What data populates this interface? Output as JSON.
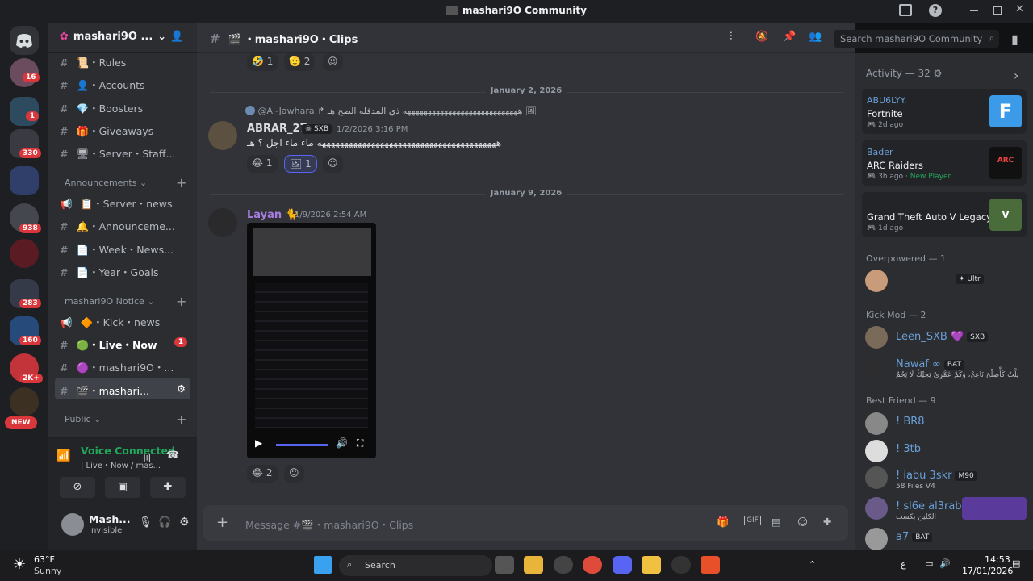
{
  "window": {
    "title": "mashari9O Community"
  },
  "server": {
    "name": "mashari9O ..."
  },
  "badges": [
    "16",
    "1",
    "330",
    "938",
    "283",
    "160",
    "2K+",
    "NEW"
  ],
  "channels": {
    "items": [
      {
        "label": "・Rules",
        "icon": "📜"
      },
      {
        "label": "・Accounts",
        "icon": "👤"
      },
      {
        "label": "・Boosters",
        "icon": "💎"
      },
      {
        "label": "・Giveaways",
        "icon": "🎁"
      },
      {
        "label": "・Server・Staff...",
        "icon": "🖥"
      }
    ],
    "cat_announcements": "Announcements",
    "announce_items": [
      {
        "label": "・Server・news",
        "icon": "📋"
      },
      {
        "label": "・Announceme...",
        "icon": "🔔"
      },
      {
        "label": "・Week・News...",
        "icon": "📄"
      },
      {
        "label": "・Year・Goals",
        "icon": "📄"
      }
    ],
    "cat_notice": "mashari9O Notice",
    "notice_items": [
      {
        "label": "・Kick・news",
        "icon": "🔶"
      },
      {
        "label": "・Live・Now",
        "icon": "🟢",
        "badge": "1"
      },
      {
        "label": "・mashari9O・...",
        "icon": "🟣"
      },
      {
        "label": "・mashari...",
        "icon": "🎬"
      }
    ],
    "cat_public": "Public"
  },
  "voice": {
    "status": "Voice Connected",
    "sub": "| Live・Now / mas..."
  },
  "user": {
    "name": "Mash...",
    "status": "Invisible"
  },
  "header": {
    "channel": "・mashari9O・Clips"
  },
  "search": {
    "placeholder": "Search mashari9O Community"
  },
  "messages": {
    "top_reacts": [
      "1",
      "2"
    ],
    "date1": "January 2, 2026",
    "reply_user": "@Al-Jawhara",
    "reply_text": "ذي المدفله الصح هـ",
    "reply_tail": "ههههههههههههههههههههههههههههه",
    "m1_user": "ABRAR_27",
    "m1_tag": "SXB",
    "m1_time": "1/2/2026 3:16 PM",
    "m1_text": "ماء ماء اجل ؟ هـ",
    "m1_tail": "ههههههههههههههههههههههههههههههههههههههههه",
    "m1_reacts": [
      "1",
      "1"
    ],
    "date2": "January 9, 2026",
    "m2_user": "Layan",
    "m2_time": "1/9/2026 2:54 AM",
    "m2_reacts": [
      "2"
    ]
  },
  "input": {
    "placeholder": "Message #🎬・mashari9O・Clips"
  },
  "members": {
    "activity_title": "Activity — 32",
    "activities": [
      {
        "user": "ABU6LYY.",
        "game": "Fortnite",
        "time": "2d ago",
        "extra": ""
      },
      {
        "user": "Bader",
        "game": "ARC Raiders",
        "time": "3h ago",
        "extra": "New Player"
      },
      {
        "user": "",
        "game": "Grand Theft Auto V Legacy",
        "time": "1d ago",
        "extra": ""
      }
    ],
    "sec_overpowered": "Overpowered — 1",
    "overpowered": [
      {
        "name": "",
        "tag": "Ultr",
        "sub": ""
      }
    ],
    "sec_kick": "Kick Mod — 2",
    "kick": [
      {
        "name": "Leen_SXB",
        "tag": "SXB",
        "sub": ""
      },
      {
        "name": "Nawaf",
        "tag": "BAT",
        "sub": "يلَّتْ كَأْصِلْحَ نَاعِجْ، وَكَمْ عَمَّرِيْ يَحِيْكُ لَا يَحُمُ"
      }
    ],
    "sec_best": "Best Friend — 9",
    "best": [
      {
        "name": "! BR8",
        "tag": "",
        "sub": ""
      },
      {
        "name": "! 3tb",
        "tag": "",
        "sub": ""
      },
      {
        "name": "! iabu 3skr",
        "tag": "M90",
        "sub": "58 Files V4"
      },
      {
        "name": "! sl6e al3rab",
        "tag": "",
        "sub": "الكلين بكسب"
      },
      {
        "name": "a7",
        "tag": "BAT",
        "sub": ""
      }
    ]
  },
  "taskbar": {
    "weather_temp": "63°F",
    "weather_desc": "Sunny",
    "search": "Search",
    "time": "14:53",
    "date": "17/01/2026",
    "lang": "ع"
  }
}
